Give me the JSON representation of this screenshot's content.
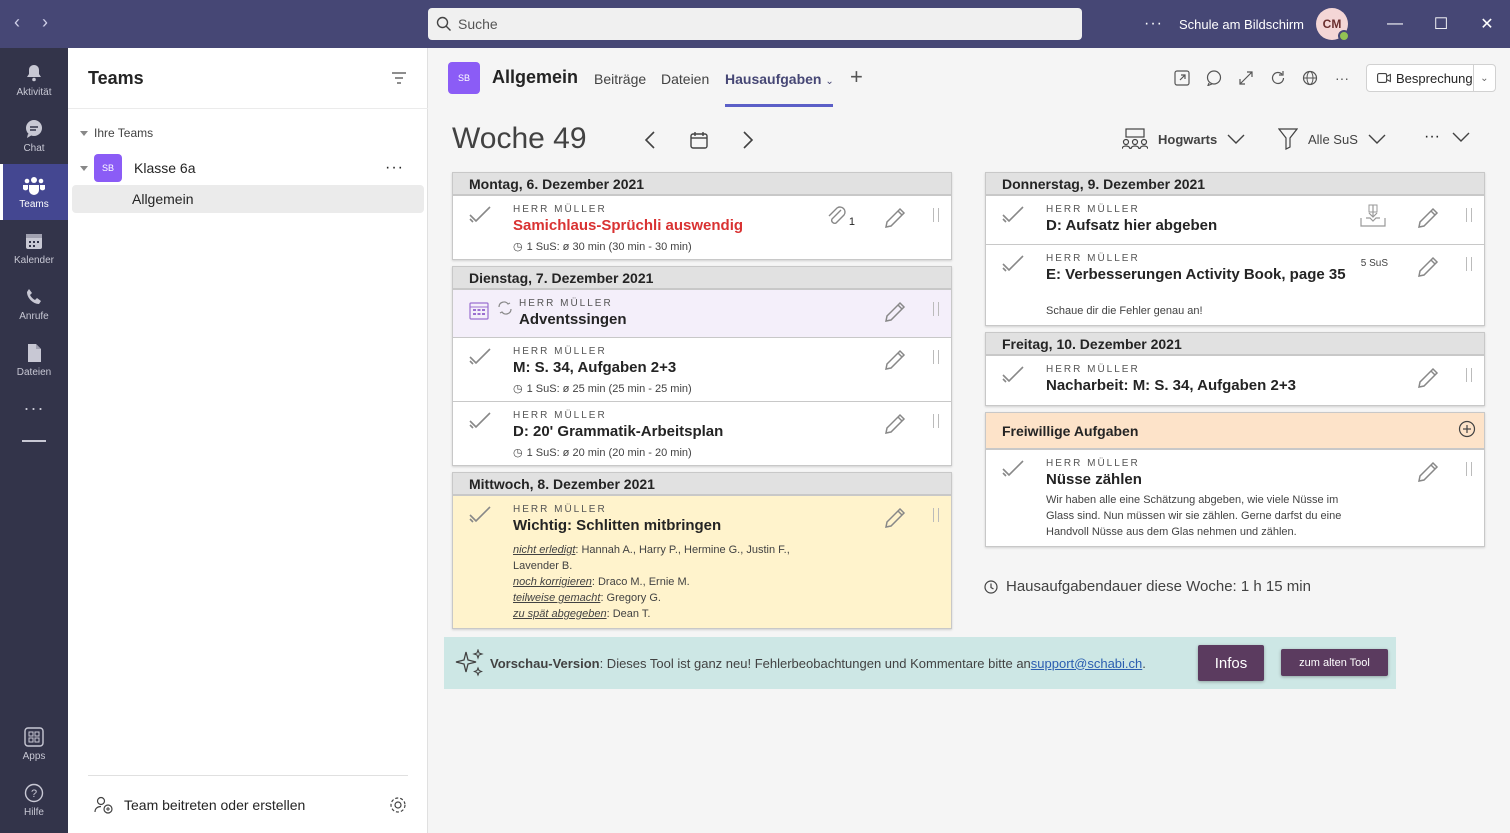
{
  "titlebar": {
    "search_placeholder": "Suche",
    "more": "···",
    "org_name": "Schule am Bildschirm",
    "avatar_initials": "CM"
  },
  "rail": [
    {
      "label": "Aktivität"
    },
    {
      "label": "Chat"
    },
    {
      "label": "Teams"
    },
    {
      "label": "Kalender"
    },
    {
      "label": "Anrufe"
    },
    {
      "label": "Dateien"
    },
    {
      "label": "Apps"
    },
    {
      "label": "Hilfe"
    }
  ],
  "teams_panel": {
    "title": "Teams",
    "section": "Ihre Teams",
    "team": {
      "badge": "SB",
      "name": "Klasse 6a",
      "more": "···"
    },
    "channel": "Allgemein",
    "join": "Team beitreten oder erstellen"
  },
  "channel": {
    "badge": "SB",
    "name": "Allgemein",
    "tabs": [
      "Beiträge",
      "Dateien",
      "Hausaufgaben"
    ],
    "meeting_button": "Besprechung"
  },
  "week": {
    "title": "Woche 49",
    "school": "Hogwarts",
    "filter": "Alle SuS",
    "more": "···"
  },
  "left_days": [
    {
      "header": "Montag, 6. Dezember 2021",
      "tasks": [
        {
          "teacher": "HERR MÜLLER",
          "title": "Samichlaus-Sprüchli auswendig",
          "meta": "1 SuS: ø 30 min (30 min - 30 min)",
          "attach_count": "1"
        }
      ]
    },
    {
      "header": "Dienstag, 7. Dezember 2021",
      "tasks": [
        {
          "teacher": "HERR MÜLLER",
          "title": "Adventssingen"
        },
        {
          "teacher": "HERR MÜLLER",
          "title": "M: S. 34, Aufgaben 2+3",
          "meta": "1 SuS: ø 25 min (25 min - 25 min)"
        },
        {
          "teacher": "HERR MÜLLER",
          "title": "D: 20' Grammatik-Arbeitsplan",
          "meta": "1 SuS: ø 20 min (20 min - 20 min)"
        }
      ]
    },
    {
      "header": "Mittwoch, 8. Dezember 2021",
      "tasks": [
        {
          "teacher": "HERR MÜLLER",
          "title": "Wichtig: Schlitten mitbringen",
          "status_lines": [
            {
              "label": "nicht erledigt",
              "names": ": Hannah A., Harry P., Hermine G., Justin F., Lavender B."
            },
            {
              "label": "noch korrigieren",
              "names": ": Draco M., Ernie M."
            },
            {
              "label": "teilweise gemacht",
              "names": ": Gregory G."
            },
            {
              "label": "zu spät abgegeben",
              "names": ": Dean T."
            }
          ]
        }
      ]
    }
  ],
  "right_days": [
    {
      "header": "Donnerstag, 9. Dezember 2021",
      "tasks": [
        {
          "teacher": "HERR MÜLLER",
          "title": "D: Aufsatz hier abgeben"
        },
        {
          "teacher": "HERR MÜLLER",
          "title": "E: Verbesserungen Activity Book, page 35",
          "note": "Schaue dir die Fehler genau an!",
          "sus_count": "5 SuS"
        }
      ]
    },
    {
      "header": "Freitag, 10. Dezember 2021",
      "tasks": [
        {
          "teacher": "HERR MÜLLER",
          "title": "Nacharbeit: M: S. 34, Aufgaben 2+3"
        }
      ]
    },
    {
      "header": "Freiwillige Aufgaben",
      "tasks": [
        {
          "teacher": "HERR MÜLLER",
          "title": "Nüsse zählen",
          "note": "Wir haben alle eine Schätzung abgeben, wie viele Nüsse im Glass sind. Nun müssen wir sie zählen. Gerne darfst du eine Handvoll Nüsse aus dem Glas nehmen und zählen."
        }
      ]
    }
  ],
  "summary": "Hausaufgabendauer diese Woche: 1 h 15 min",
  "banner": {
    "bold": "Vorschau-Version",
    "text": ": Dieses Tool ist ganz neu! Fehlerbeobachtungen und Kommentare bitte an ",
    "link": "support@schabi.ch",
    "after": ".",
    "info_button": "Infos",
    "old_button": "zum alten Tool"
  },
  "colors": {
    "titlebar": "#464775",
    "rail": "#33344a",
    "accent": "#5b5fc7",
    "red_title": "#d93232",
    "purple_row": "#f4effa",
    "yellow_row": "#fff3cc",
    "peach_header": "#fde3c9",
    "banner": "#cde7e5",
    "button": "#5b3b5f"
  }
}
